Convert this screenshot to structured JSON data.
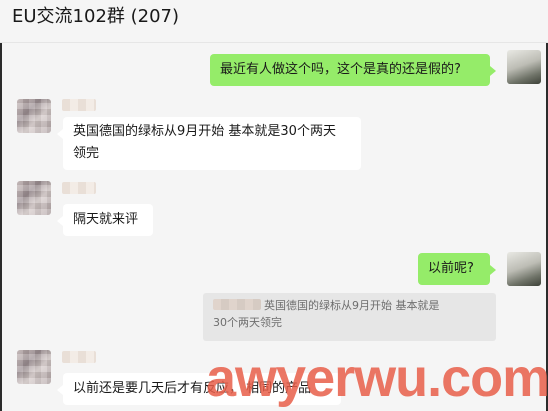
{
  "header": {
    "title": "EU交流102群 (207)"
  },
  "messages": [
    {
      "from": "me",
      "text": "最近有人做这个吗，这个是真的还是假的?"
    },
    {
      "from": "other",
      "line1": "英国德国的绿标从9月开始 基本就是30个两天",
      "line2": "领完"
    },
    {
      "from": "other",
      "text": "隔天就来评"
    },
    {
      "from": "me",
      "text": "以前呢?"
    },
    {
      "from": "me",
      "quote_line1": "英国德国的绿标从9月开始 基本就是",
      "quote_line2": "30个两天领完"
    },
    {
      "from": "other",
      "text": "以前还是要几天后才有反应， 相同的产品"
    }
  ],
  "watermark": "awyerwu.com",
  "colors": {
    "me_bubble": "#95ec69",
    "other_bubble": "#ffffff",
    "background": "#f5f5f5"
  }
}
